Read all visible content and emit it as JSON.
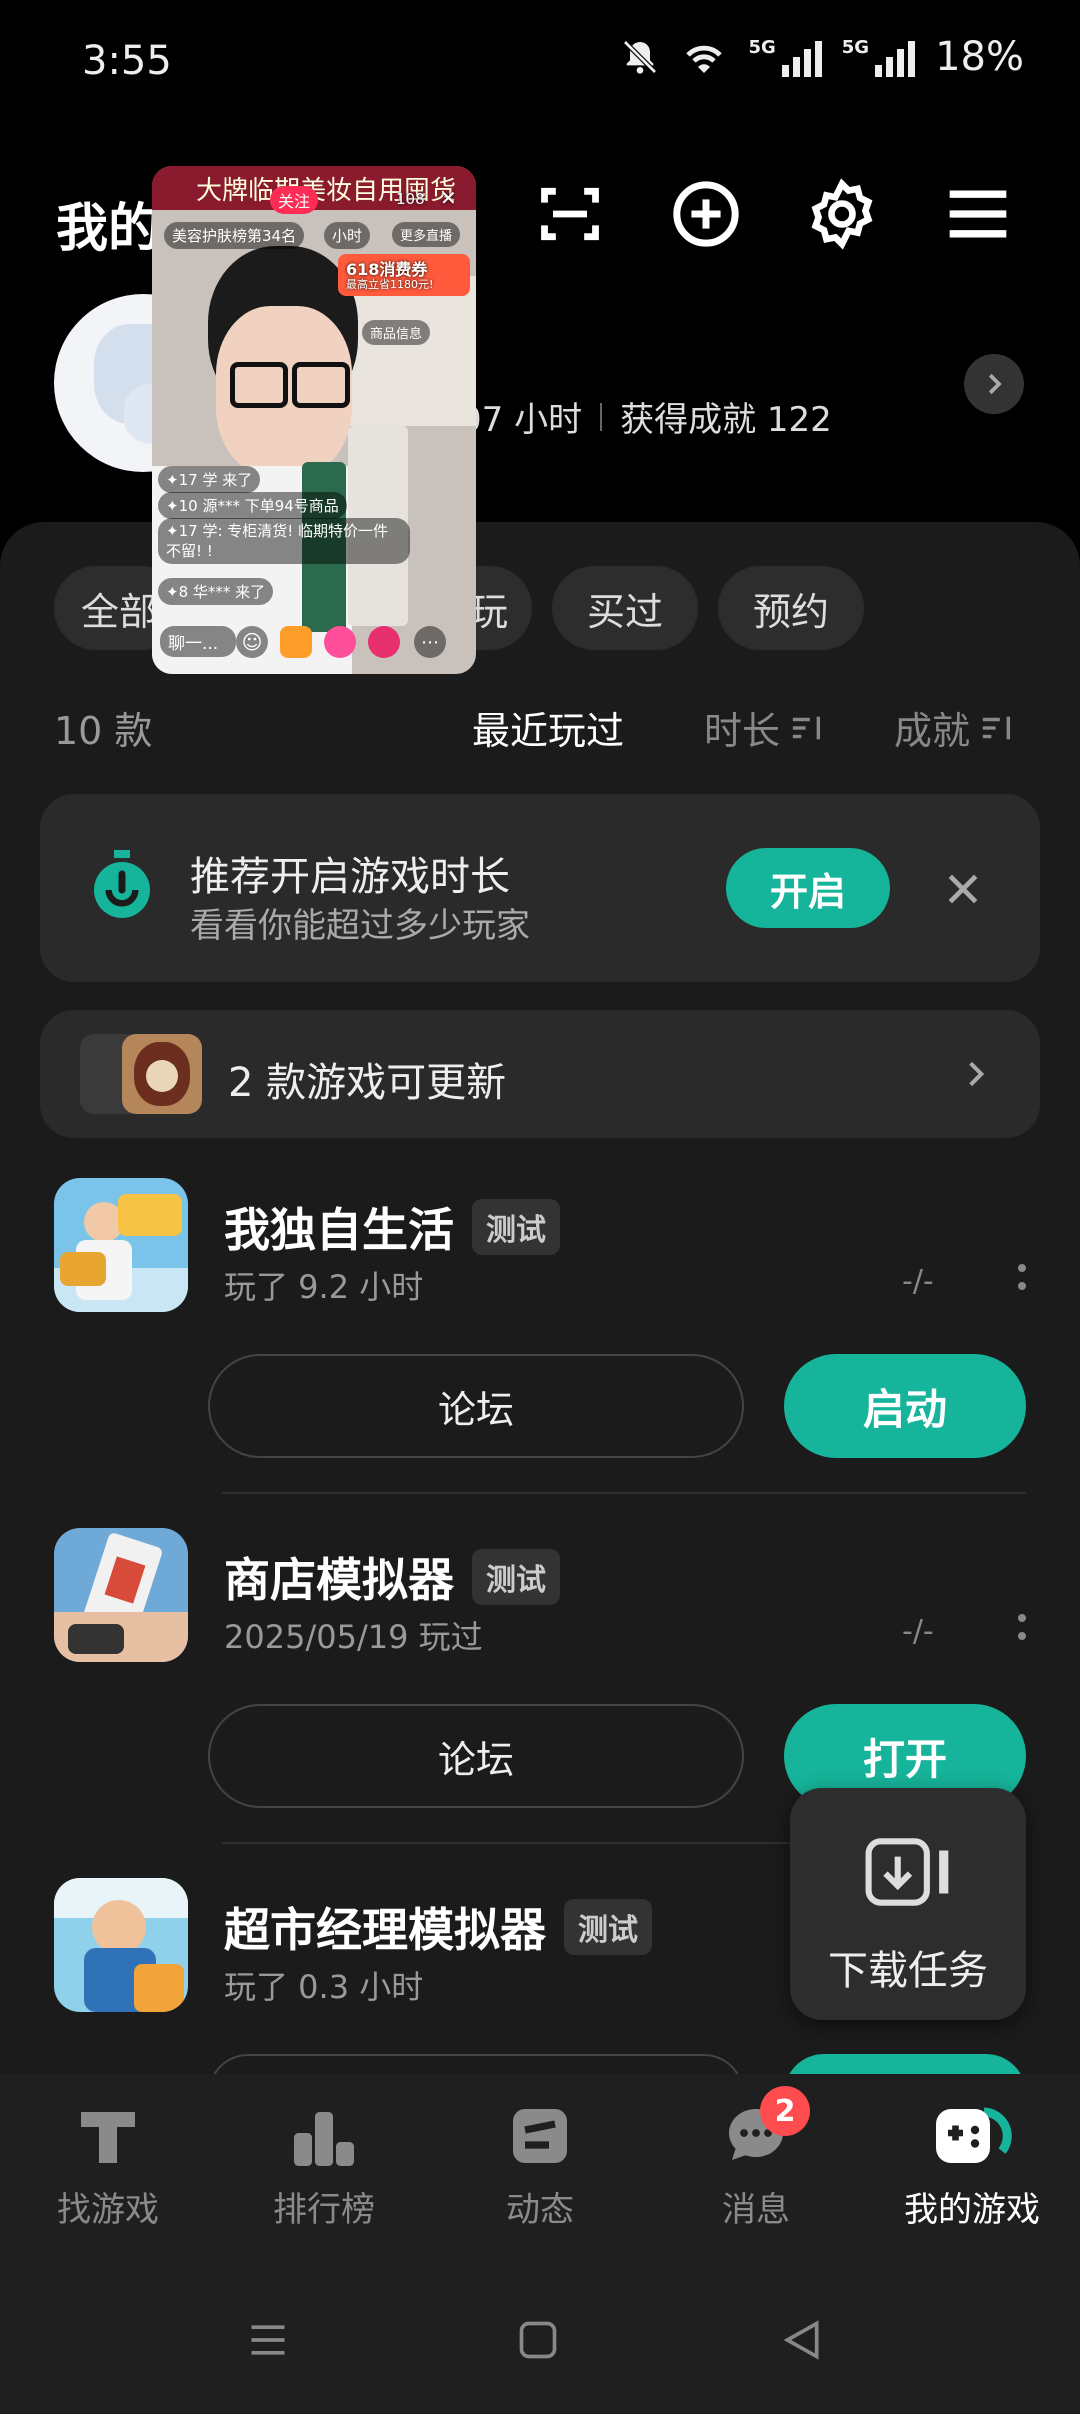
{
  "status_bar": {
    "time": "3:55",
    "network1": "5G",
    "network2": "5G",
    "battery": "18%"
  },
  "header": {
    "title": "我的"
  },
  "profile": {
    "playtime": "07 小时",
    "achievements": "获得成就 122"
  },
  "filters": {
    "chips": [
      "全部",
      "玩",
      "买过",
      "预约"
    ]
  },
  "list_header": {
    "count": "10 款",
    "sort_recent": "最近玩过",
    "sort_duration": "时长",
    "sort_achievement": "成就"
  },
  "recommend_card": {
    "title": "推荐开启游戏时长",
    "subtitle": "看看你能超过多少玩家",
    "button": "开启"
  },
  "update_card": {
    "text": "2 款游戏可更新"
  },
  "games": [
    {
      "name": "我独自生活",
      "tag": "测试",
      "sub": "玩了 9.2 小时",
      "meta": "-/-",
      "forum": "论坛",
      "action": "启动"
    },
    {
      "name": "商店模拟器",
      "tag": "测试",
      "sub": "2025/05/19 玩过",
      "meta": "-/-",
      "forum": "论坛",
      "action": "打开"
    },
    {
      "name": "超市经理模拟器",
      "tag": "测试",
      "sub": "玩了 0.3 小时"
    }
  ],
  "download_popup": {
    "label": "下载任务"
  },
  "bottom_nav": [
    {
      "label": "找游戏"
    },
    {
      "label": "排行榜"
    },
    {
      "label": "动态"
    },
    {
      "label": "消息",
      "badge": "2"
    },
    {
      "label": "我的游戏"
    }
  ],
  "live_overlay": {
    "banner": "大牌临期美妆自用囤货",
    "follow": "关注",
    "viewers": "108",
    "rank": "美容护肤榜第34名",
    "hour": "小时",
    "more_live": "更多直播",
    "coupon": "618消费券",
    "coupon_sub": "最高立省1180元!",
    "product_info": "商品信息",
    "comments": [
      {
        "level": "17",
        "text": "学 来了"
      },
      {
        "level": "10",
        "text": "源*** 下单94号商品"
      },
      {
        "level": "17",
        "text": "学: 专柜清货! 临期特价一件不留! !"
      },
      {
        "level": "8",
        "text": "华*** 来了"
      }
    ],
    "chat_placeholder": "聊一..."
  },
  "colors": {
    "accent": "#16b49a",
    "panel": "#1b1b1b",
    "badge": "#ff4d4f"
  }
}
